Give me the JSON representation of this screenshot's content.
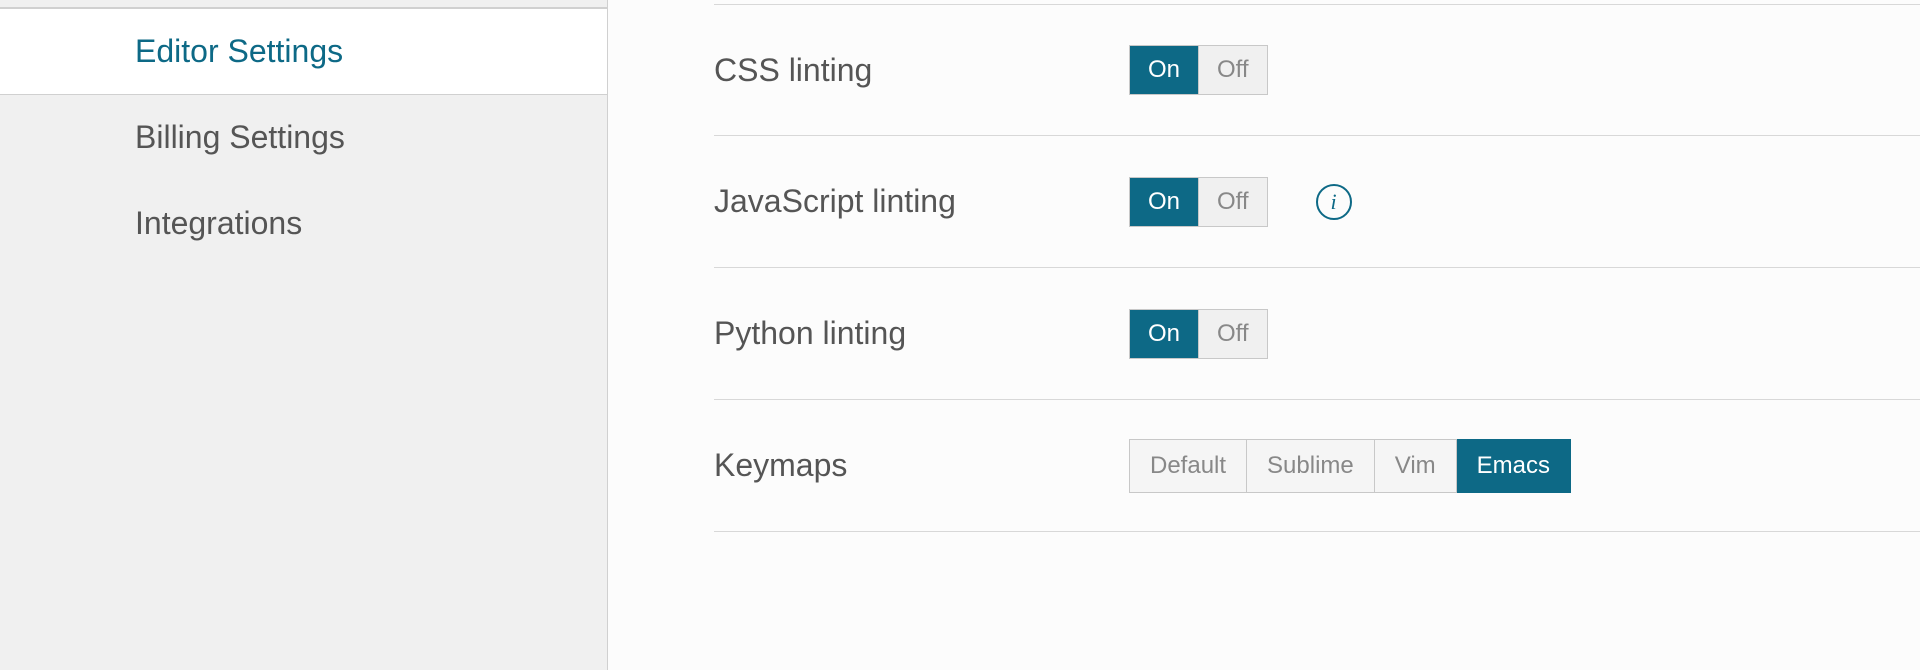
{
  "sidebar": {
    "items": [
      {
        "label": "Editor Settings",
        "active": true
      },
      {
        "label": "Billing Settings",
        "active": false
      },
      {
        "label": "Integrations",
        "active": false
      }
    ]
  },
  "settings": {
    "css_linting": {
      "label": "CSS linting",
      "on_label": "On",
      "off_label": "Off",
      "value": "On"
    },
    "js_linting": {
      "label": "JavaScript linting",
      "on_label": "On",
      "off_label": "Off",
      "value": "On",
      "has_info": true
    },
    "python_linting": {
      "label": "Python linting",
      "on_label": "On",
      "off_label": "Off",
      "value": "On"
    },
    "keymaps": {
      "label": "Keymaps",
      "options": [
        "Default",
        "Sublime",
        "Vim",
        "Emacs"
      ],
      "value": "Emacs"
    }
  },
  "info_glyph": "i"
}
